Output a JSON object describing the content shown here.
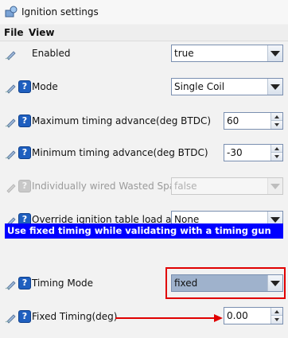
{
  "window": {
    "title": "Ignition settings"
  },
  "menu": {
    "file": "File",
    "view": "View"
  },
  "settings": {
    "enabled": {
      "label": "Enabled",
      "value": "true"
    },
    "mode": {
      "label": "Mode",
      "value": "Single Coil"
    },
    "max_timing_advance": {
      "label": "Maximum timing advance(deg BTDC)",
      "value": "60"
    },
    "min_timing_advance": {
      "label": "Minimum timing advance(deg BTDC)",
      "value": "-30"
    },
    "wasted_spark": {
      "label": "Individually wired Wasted Spark",
      "value": "false"
    },
    "override_load_axis": {
      "label": "Override ignition table load axis",
      "value": "None"
    },
    "section_banner": "Use fixed timing while validating with a timing gun",
    "timing_mode": {
      "label": "Timing Mode",
      "value": "fixed"
    },
    "fixed_timing": {
      "label": "Fixed Timing(deg)",
      "value": "0.00"
    }
  },
  "help_glyph": "?",
  "colors": {
    "banner_bg": "#0000ff",
    "annotation_red": "#e00000",
    "help_icon": "#1f5fbf",
    "selected_combo": "#9fb2cc"
  }
}
